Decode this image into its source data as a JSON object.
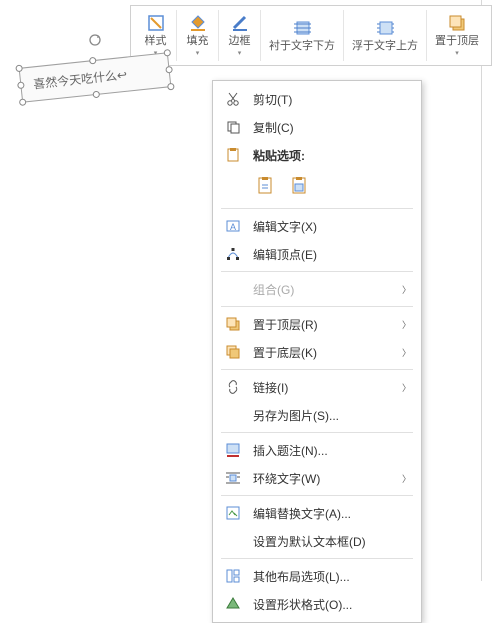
{
  "shape": {
    "text": "喜然今天吃什么↩"
  },
  "toolbar": {
    "style": "样式",
    "fill": "填充",
    "border": "边框",
    "behind": "衬于文字下方",
    "front": "浮于文字上方",
    "top": "置于顶层"
  },
  "menu": {
    "cut": "剪切(T)",
    "copy": "复制(C)",
    "paste_opts": "粘贴选项:",
    "edit_text": "编辑文字(X)",
    "edit_points": "编辑顶点(E)",
    "group": "组合(G)",
    "bring_top": "置于顶层(R)",
    "send_bottom": "置于底层(K)",
    "link": "链接(I)",
    "save_pic": "另存为图片(S)...",
    "caption": "插入题注(N)...",
    "wrap": "环绕文字(W)",
    "alt_text": "编辑替换文字(A)...",
    "default_tb": "设置为默认文本框(D)",
    "more_layout": "其他布局选项(L)...",
    "format_shape": "设置形状格式(O)..."
  }
}
